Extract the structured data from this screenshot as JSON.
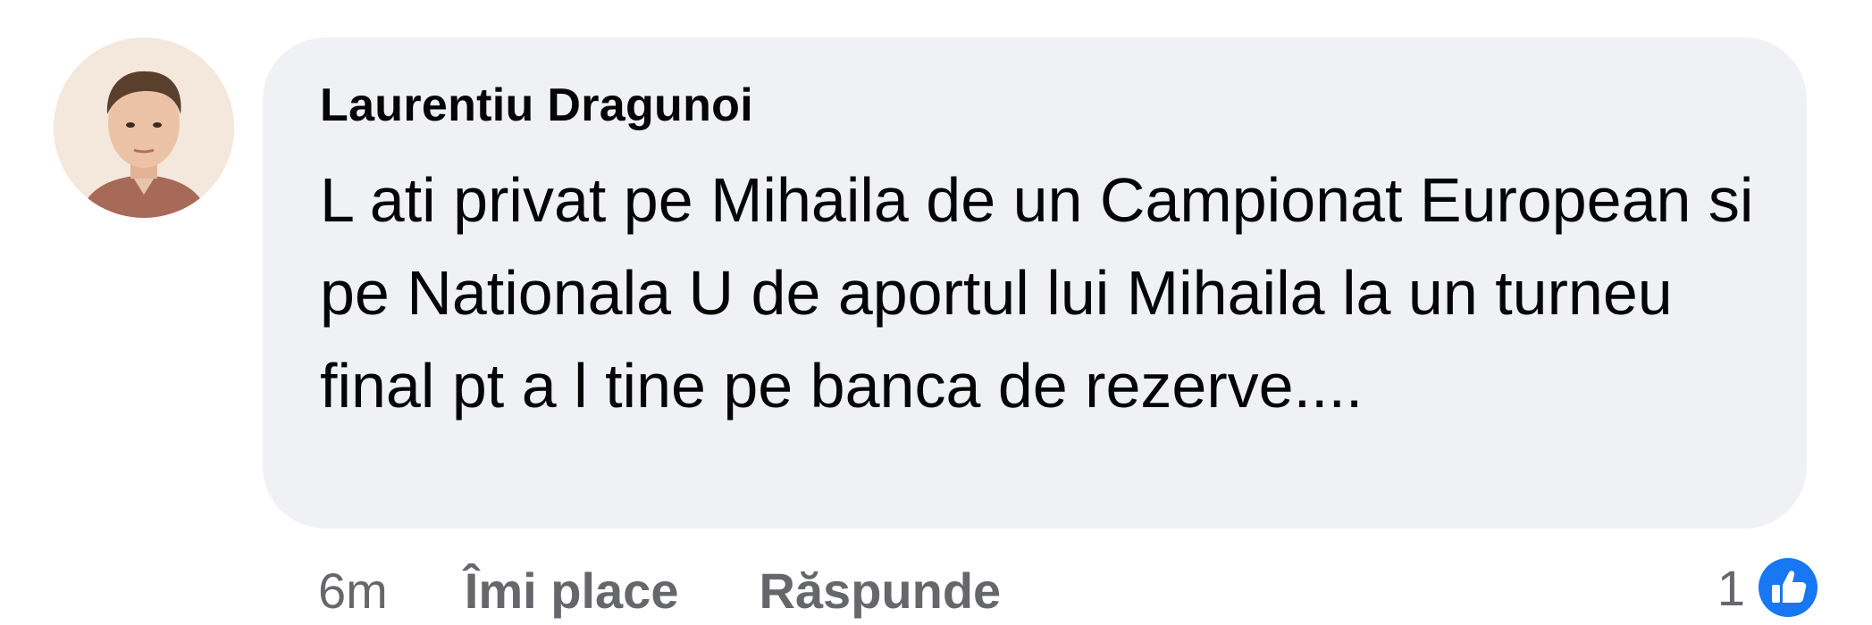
{
  "comment": {
    "author": "Laurentiu Dragunoi",
    "text": "L ati privat pe Mihaila de un Campionat European si pe Nationala U de aportul lui Mihaila la un turneu final pt a l tine pe banca de rezerve....",
    "avatar_icon": "user-avatar",
    "actions": {
      "time": "6m",
      "like_label": "Îmi place",
      "reply_label": "Răspunde"
    },
    "reactions": {
      "count": "1",
      "icon": "thumbs-up-icon",
      "color": "#1877f2"
    }
  },
  "colors": {
    "bubble": "#eff1f5",
    "text": "#050505",
    "secondary": "#65676b"
  }
}
